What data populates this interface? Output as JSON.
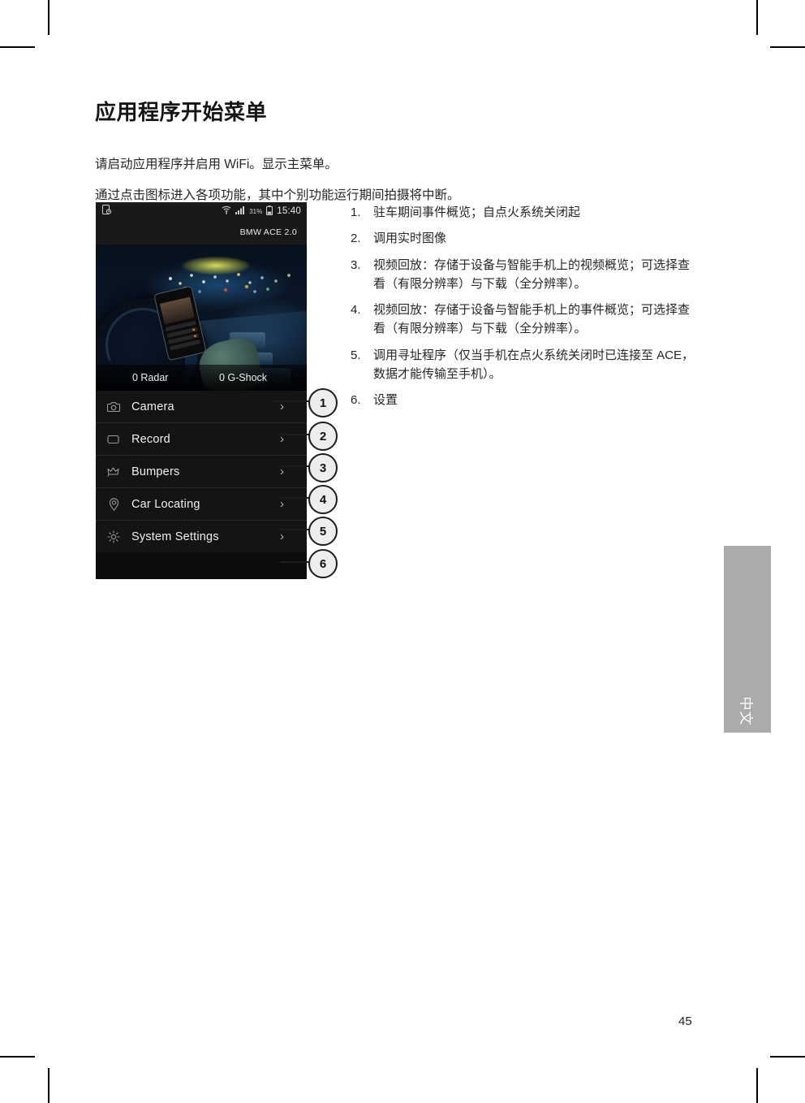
{
  "page": {
    "title": "应用程序开始菜单",
    "intro_line_1": "请启动应用程序并启用 WiFi。显示主菜单。",
    "intro_line_2": "通过点击图标进入各项功能，其中个别功能运行期间拍摄将中断。",
    "page_number": "45",
    "side_tab_label": "中文"
  },
  "phone": {
    "statusbar": {
      "notification_icon": "screenshot-icon",
      "wifi_icon": "wifi-icon",
      "signal_icon": "signal-bars-icon",
      "battery_percent": "31%",
      "battery_icon": "battery-icon",
      "clock": "15:40"
    },
    "app_title": "BMW ACE 2.0",
    "counters": {
      "radar": "0 Radar",
      "gshock": "0 G-Shock"
    },
    "menu_items": [
      {
        "icon": "camera-icon",
        "label": "Camera",
        "chevron": "›"
      },
      {
        "icon": "video-record-icon",
        "label": "Record",
        "chevron": "›"
      },
      {
        "icon": "bumper-crown-icon",
        "label": "Bumpers",
        "chevron": "›"
      },
      {
        "icon": "location-pin-icon",
        "label": "Car Locating",
        "chevron": "›"
      },
      {
        "icon": "gear-icon",
        "label": "System Settings",
        "chevron": "›"
      }
    ]
  },
  "callouts": [
    {
      "number": "1"
    },
    {
      "number": "2"
    },
    {
      "number": "3"
    },
    {
      "number": "4"
    },
    {
      "number": "5"
    },
    {
      "number": "6"
    }
  ],
  "notes": [
    {
      "num": "1.",
      "text": "驻车期间事件概览；自点火系统关闭起"
    },
    {
      "num": "2.",
      "text": "调用实时图像"
    },
    {
      "num": "3.",
      "text": "视频回放：存储于设备与智能手机上的视频概览；可选择查看（有限分辨率）与下载（全分辨率）。"
    },
    {
      "num": "4.",
      "text": "视频回放：存储于设备与智能手机上的事件概览；可选择查看（有限分辨率）与下载（全分辨率）。"
    },
    {
      "num": "5.",
      "text": "调用寻址程序（仅当手机在点火系统关闭时已连接至 ACE，数据才能传输至手机）。"
    },
    {
      "num": "6.",
      "text": "设置"
    }
  ],
  "colors": {
    "phone_background": "#0c0c0c",
    "status_bar": "#191919",
    "menu_background": "#141414",
    "side_tab": "#ababab",
    "text": "#262626"
  }
}
